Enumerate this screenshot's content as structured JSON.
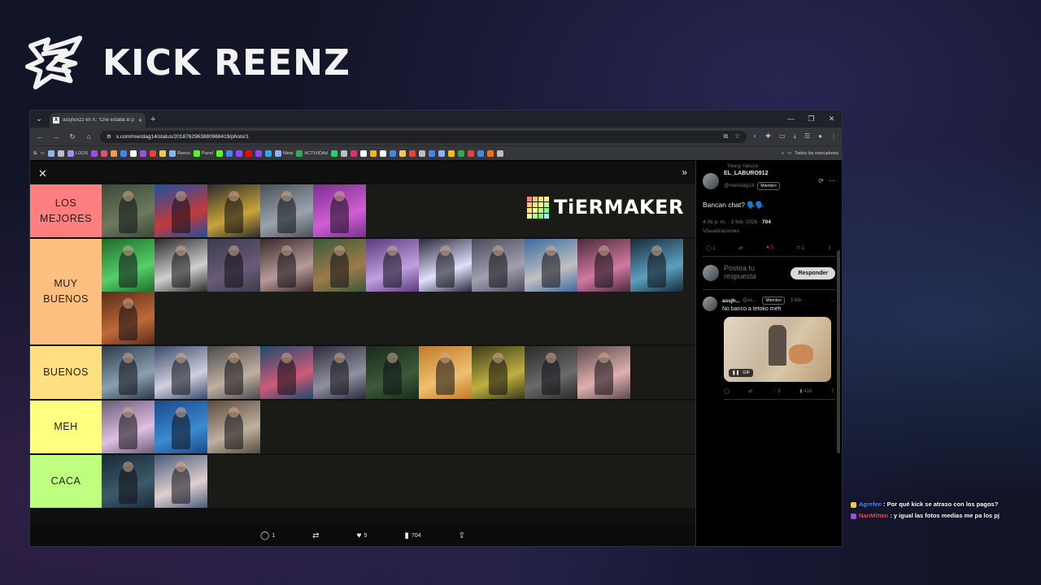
{
  "overlay": {
    "brand_name": "KICK REENZ",
    "chat": [
      {
        "user": "Agrefee",
        "message": ": Por qué kick se atraso con los pagos?",
        "color": "#4a8ef0",
        "icon_color": "#f2c94c"
      },
      {
        "user": "NanMitten",
        "message": ": y igual las fotos medias me pa los pj",
        "color": "#e0506a",
        "icon_color": "#9b51e0"
      }
    ]
  },
  "browser": {
    "tab_title": "assjhoxzz en X: \"Che estaba al p",
    "url": "x.com/meridag14/status/2018762963880968419/photo/1",
    "bookmarks": [
      {
        "label": "",
        "color": "#8ab4f8"
      },
      {
        "label": "",
        "color": "#bdbdbd"
      },
      {
        "label": "LOOS",
        "color": "#a78bfa"
      },
      {
        "label": "",
        "color": "#9b51e0"
      },
      {
        "label": "",
        "color": "#e0506a"
      },
      {
        "label": "",
        "color": "#f2994a"
      },
      {
        "label": "",
        "color": "#4285f4"
      },
      {
        "label": "",
        "color": "#ffffff"
      },
      {
        "label": "",
        "color": "#9b51e0"
      },
      {
        "label": "",
        "color": "#e94235"
      },
      {
        "label": "",
        "color": "#f2c94c"
      },
      {
        "label": "Reenz",
        "color": "#8ab4f8"
      },
      {
        "label": "Panel",
        "color": "#53fc18"
      },
      {
        "label": "",
        "color": "#53fc18"
      },
      {
        "label": "",
        "color": "#4285f4"
      },
      {
        "label": "",
        "color": "#9146ff"
      },
      {
        "label": "",
        "color": "#ff0000"
      },
      {
        "label": "",
        "color": "#9146ff"
      },
      {
        "label": "",
        "color": "#29a9eb"
      },
      {
        "label": "Meta",
        "color": "#8ab4f8"
      },
      {
        "label": "ACTIVIDAd",
        "color": "#34a853"
      },
      {
        "label": "",
        "color": "#25d366"
      },
      {
        "label": "",
        "color": "#bdbdbd"
      },
      {
        "label": "",
        "color": "#e1306c"
      },
      {
        "label": "",
        "color": "#ffffff"
      },
      {
        "label": "",
        "color": "#f0b90b"
      },
      {
        "label": "",
        "color": "#ffffff"
      },
      {
        "label": "",
        "color": "#4285f4"
      },
      {
        "label": "",
        "color": "#f2c94c"
      },
      {
        "label": "",
        "color": "#ea4335"
      },
      {
        "label": "",
        "color": "#bdbdbd"
      },
      {
        "label": "",
        "color": "#4285f4"
      },
      {
        "label": "",
        "color": "#8ab4f8"
      },
      {
        "label": "",
        "color": "#fbbc04"
      },
      {
        "label": "",
        "color": "#34a853"
      },
      {
        "label": "",
        "color": "#ea4335"
      },
      {
        "label": "",
        "color": "#4285f4"
      },
      {
        "label": "",
        "color": "#ff6d01"
      },
      {
        "label": "",
        "color": "#bdbdbd"
      }
    ],
    "all_bookmarks_label": "Todos los marcadores"
  },
  "tierlist": {
    "brand": "TiERMAKER",
    "tiers": [
      {
        "label": "LOS MEJORES",
        "color": "#ff7f7f",
        "count": 5,
        "rows": 1
      },
      {
        "label": "MUY BUENOS",
        "color": "#ffbf7f",
        "count": 12,
        "rows": 2
      },
      {
        "label": "BUENOS",
        "color": "#ffdf7f",
        "count": 10,
        "rows": 1
      },
      {
        "label": "MEH",
        "color": "#ffff7f",
        "count": 3,
        "rows": 1
      },
      {
        "label": "CACA",
        "color": "#bfff7f",
        "count": 2,
        "rows": 1
      }
    ],
    "thumb_palettes": [
      [
        "#3a4a3a",
        "#6b7a5a"
      ],
      [
        "#1d4fa3",
        "#c23b3b"
      ],
      [
        "#2b2b2b",
        "#c9a43a"
      ],
      [
        "#4a5058",
        "#9aa3ad"
      ],
      [
        "#7a2f8f",
        "#d25ed4"
      ],
      [
        "#1f6b2a",
        "#55d06a"
      ],
      [
        "#2a2a2a",
        "#d0d0d0"
      ],
      [
        "#3b3b4a",
        "#6a5a7a"
      ],
      [
        "#3a2a2a",
        "#b89a9a"
      ],
      [
        "#3a5a3a",
        "#a07a4a"
      ],
      [
        "#5a3a7a",
        "#c0a0e0"
      ],
      [
        "#2a2a3a",
        "#e0e0ff"
      ],
      [
        "#4a4a5a",
        "#a0a0b0"
      ],
      [
        "#3a6aa0",
        "#c0c0c0"
      ],
      [
        "#4a2a3a",
        "#d07aa0"
      ],
      [
        "#1a2a3a",
        "#5aa0c0"
      ],
      [
        "#5a2a1a",
        "#c06a3a"
      ],
      [
        "#2a3a4a",
        "#8aa0b0"
      ],
      [
        "#3a4a6a",
        "#d0d0e0"
      ],
      [
        "#4a4a4a",
        "#c0b0a0"
      ],
      [
        "#1a4a6a",
        "#d05a7a"
      ],
      [
        "#2a2a3a",
        "#9090a0"
      ],
      [
        "#1a2a1a",
        "#3a5a3a"
      ],
      [
        "#c07a2a",
        "#f0c070"
      ],
      [
        "#3a3a1a",
        "#c0b040"
      ],
      [
        "#2a2a2a",
        "#6a6a6a"
      ],
      [
        "#5a4a4a",
        "#e0b0b0"
      ],
      [
        "#6a5a7a",
        "#e0c0e0"
      ],
      [
        "#1a4a8a",
        "#3a8ad0"
      ],
      [
        "#5a4a3a",
        "#c0b0a0"
      ],
      [
        "#1a2a3a",
        "#3a5a6a"
      ],
      [
        "#4a5a7a",
        "#e0d0d0"
      ]
    ]
  },
  "post_actions": {
    "replies": "1",
    "likes": "5",
    "views": "704"
  },
  "sidebar": {
    "repost_context": "Young Yakuza",
    "author_name": "EL_LABURO912",
    "author_handle": "@meridag14",
    "author_badge": "Miembro",
    "post_text": "Bancan chat? 🗣️🗣️",
    "post_time": "4:06 p. m. · 3 feb. 2026 · ",
    "post_views": "704",
    "views_label": "Visualizaciones",
    "stats": {
      "replies": "1",
      "reposts": "",
      "likes": "5",
      "bookmarks": "1"
    },
    "reply_placeholder": "Postea tu respuesta",
    "reply_button": "Responder",
    "comment": {
      "author": "assjh...",
      "handle": "@as...",
      "badge": "Miembro",
      "date": "· 3 feb.",
      "text": "No banco a tetoko meh",
      "gif_label": "GIF",
      "stats": {
        "replies": "",
        "reposts": "",
        "likes": "3",
        "views": "418"
      }
    }
  }
}
